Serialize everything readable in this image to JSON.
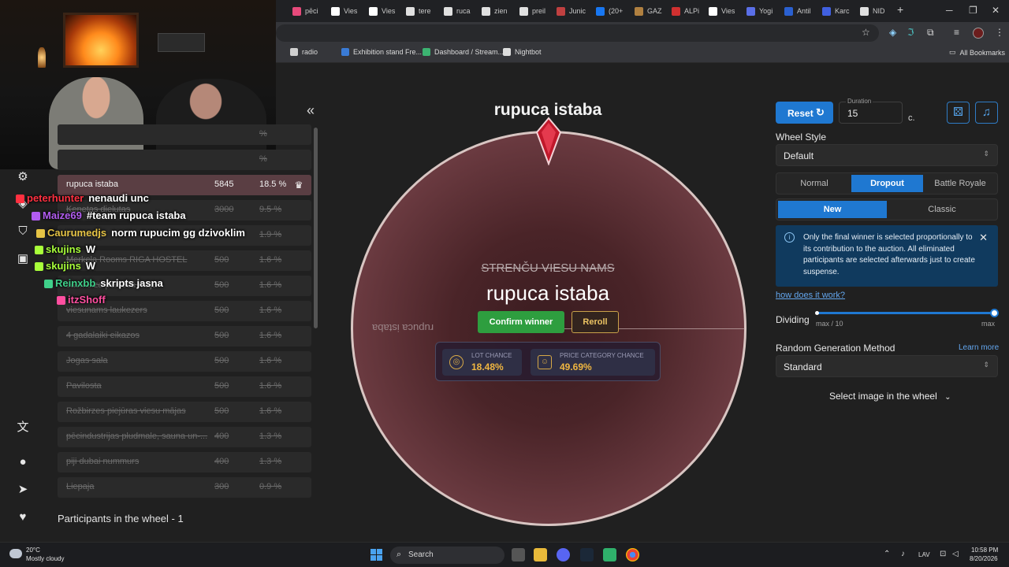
{
  "browser": {
    "tabs": [
      {
        "label": "pēci",
        "color": "#e74a7b"
      },
      {
        "label": "Vies",
        "color": "#ffffff"
      },
      {
        "label": "Vies",
        "color": "#ffffff"
      },
      {
        "label": "tere",
        "color": "#e0e0e0"
      },
      {
        "label": "ruca",
        "color": "#e0e0e0"
      },
      {
        "label": "zien",
        "color": "#e0e0e0"
      },
      {
        "label": "preil",
        "color": "#e0e0e0"
      },
      {
        "label": "Junic",
        "color": "#c04040"
      },
      {
        "label": "(20+",
        "color": "#1877f2"
      },
      {
        "label": "GAZ",
        "color": "#b08040"
      },
      {
        "label": "ALPi",
        "color": "#d03030"
      },
      {
        "label": "Vies",
        "color": "#ffffff"
      },
      {
        "label": "Yogi",
        "color": "#5a6fe8"
      },
      {
        "label": "Antil",
        "color": "#2a60d0"
      },
      {
        "label": "Karc",
        "color": "#4060e0"
      },
      {
        "label": "NID",
        "color": "#e0e0e0"
      }
    ],
    "new_tab": "+",
    "bookmarks": [
      {
        "label": "radio",
        "color": "#cfcfcf"
      },
      {
        "label": "Exhibition stand Fre...",
        "color": "#3a7bd5"
      },
      {
        "label": "Dashboard / Stream...",
        "color": "#3cb371"
      },
      {
        "label": "Nightbot",
        "color": "#dddddd"
      }
    ],
    "all_bookmarks": "All Bookmarks"
  },
  "webcam": {
    "chat": [
      {
        "user": "peterhunter",
        "msg": "nenaudi unc",
        "color": "#ff3040"
      },
      {
        "user": "Maize69",
        "msg": "#team rupuca istaba",
        "color": "#b25cf0"
      },
      {
        "user": "Caurumedjs",
        "msg": "norm rupucim gg dzivoklim",
        "color": "#e6c445"
      },
      {
        "user": "skujins",
        "msg": "W",
        "color": "#a8ff3a"
      },
      {
        "user": "skujins",
        "msg": "W",
        "color": "#a8ff3a"
      },
      {
        "user": "Reinxbb",
        "msg": "skripts jasna",
        "color": "#3fd08a"
      },
      {
        "user": "itzShoff",
        "msg": "",
        "color": "#ff4fa0"
      }
    ]
  },
  "lots": [
    {
      "name": "",
      "amount": "",
      "percent": "%"
    },
    {
      "name": "",
      "amount": "",
      "percent": "%"
    },
    {
      "name": "rupuca istaba",
      "amount": "5845",
      "percent": "18.5 %"
    },
    {
      "name": "Kenetas dielutas",
      "amount": "3000",
      "percent": "9.5 %"
    },
    {
      "name": "Plakumas",
      "amount": "",
      "percent": "1.9 %"
    },
    {
      "name": "Merkela Rooms RIGA HOSTEL",
      "amount": "500",
      "percent": "1.6 %"
    },
    {
      "name": "sasmuiza peldošā maja",
      "amount": "500",
      "percent": "1.6 %"
    },
    {
      "name": "viesunams laukezers",
      "amount": "500",
      "percent": "1.6 %"
    },
    {
      "name": "4 gadalaiki eikazos",
      "amount": "500",
      "percent": "1.6 %"
    },
    {
      "name": "Jogas sala",
      "amount": "500",
      "percent": "1.6 %"
    },
    {
      "name": "Pavilosta",
      "amount": "500",
      "percent": "1.6 %"
    },
    {
      "name": "Rožbirzes piejūras viesu mājas",
      "amount": "500",
      "percent": "1.6 %"
    },
    {
      "name": "pēcindustrijas pludmale, sauna un-...",
      "amount": "400",
      "percent": "1.3 %"
    },
    {
      "name": "piji dubai nummurs",
      "amount": "400",
      "percent": "1.3 %"
    },
    {
      "name": "Liepaja",
      "amount": "300",
      "percent": "0.9 %"
    }
  ],
  "participants_label": "Participants in the wheel - 1",
  "wheel": {
    "title": "rupuca istaba",
    "rotated_label": "rupuca istaba",
    "struck_name": "STRENČU VIESU NAMS",
    "winner": "rupuca istaba",
    "confirm": "Confirm winner",
    "reroll": "Reroll",
    "lot_chance_label": "LOT CHANCE",
    "lot_chance": "18.48%",
    "price_chance_label": "PRICE CATEGORY CHANCE",
    "price_chance": "49.69%"
  },
  "controls": {
    "reset": "Reset",
    "duration_label": "Duration",
    "duration": "15",
    "unit": "c.",
    "wheel_style_label": "Wheel Style",
    "wheel_style": "Default",
    "modes": [
      "Normal",
      "Dropout",
      "Battle Royale"
    ],
    "active_mode": "Dropout",
    "variants": [
      "New",
      "Classic"
    ],
    "active_variant": "New",
    "info": "Only the final winner is selected proportionally to its contribution to the auction. All eliminated participants are selected afterwards just to create suspense.",
    "how_link": "how does it work?",
    "dividing_label": "Dividing",
    "dividing_min": "max / 10",
    "dividing_max": "max",
    "dividing_level": 1.0,
    "random_label": "Random Generation Method",
    "learn_more": "Learn more",
    "random_value": "Standard",
    "select_image": "Select image in the wheel"
  },
  "taskbar": {
    "temp": "20°C",
    "weather": "Mostly cloudy",
    "search": "Search",
    "lang": "LAV",
    "time": "10:58 PM",
    "date": "8/20/2026"
  }
}
